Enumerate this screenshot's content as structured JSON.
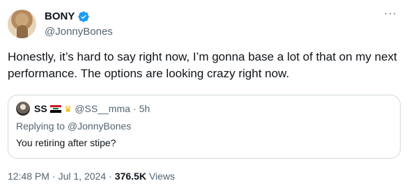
{
  "author": {
    "display_name": "BONY",
    "handle": "@JonnyBones"
  },
  "tweet": {
    "text": "Honestly, it’s hard to say right now, I’m gonna base a lot of that on my next performance. The options are looking crazy right now."
  },
  "quote": {
    "name": "SS",
    "handle": "@SS__mma",
    "separator": "·",
    "age": "5h",
    "replying_to": "Replying to @JonnyBones",
    "text": "You retiring after stipe?"
  },
  "meta": {
    "time": "12:48 PM",
    "sep1": "·",
    "date": "Jul 1, 2024",
    "sep2": "·",
    "views_count": "376.5K",
    "views_label": "Views"
  },
  "icons": {
    "more": "more-icon",
    "verified": "verified-badge-icon",
    "crown": "crown-icon",
    "flag": "iraq-flag-icon"
  },
  "colors": {
    "text": "#0f1419",
    "secondary": "#536471",
    "border": "#cfd9de",
    "verified_blue": "#1d9bf0"
  }
}
